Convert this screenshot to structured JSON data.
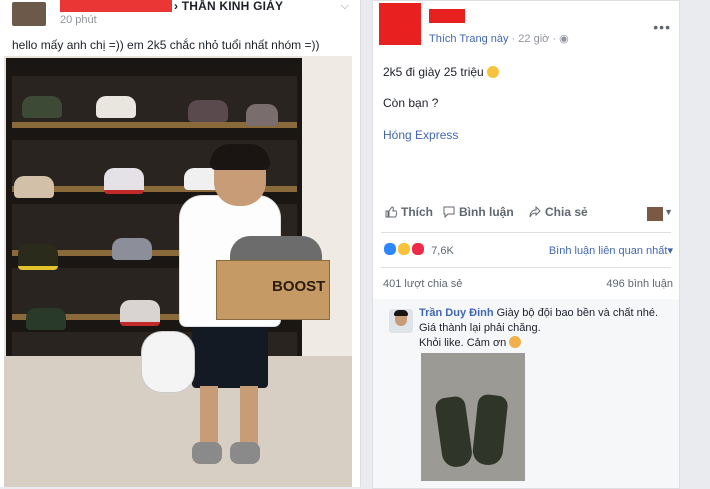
{
  "left_post": {
    "group_name": "THẦN KINH GIÀY",
    "separator": "›",
    "time": "20 phút",
    "caption": "hello mấy anh chị =)) em 2k5 chắc nhỏ tuổi nhất nhóm =))",
    "box_text": "BOOST"
  },
  "right_post": {
    "liked_page": "Thích Trang này",
    "time": "22 giờ",
    "text_line1": "2k5 đi giày 25 triệu",
    "text_line2": "Còn bạn ?",
    "link_text": "Hóng Express",
    "actions": {
      "like": "Thích",
      "comment": "Bình luận",
      "share": "Chia sẻ"
    },
    "reaction_count": "7,6K",
    "sort_label": "Bình luận liên quan nhất",
    "shares": "401 lượt chia sẻ",
    "comments_count": "496 bình luận",
    "comment": {
      "author": "Trần Duy Đinh",
      "line1": "Giày bộ đội bao bền và chất nhé.",
      "line2": "Giá thành lại phải chăng.",
      "line3": "Khỏi like. Cảm ơn"
    },
    "colors": {
      "link": "#4267b2",
      "redaction": "#e8201f",
      "like_blue": "#2d88ff",
      "love_red": "#f0284a",
      "haha_yellow": "#f7c23c"
    }
  }
}
